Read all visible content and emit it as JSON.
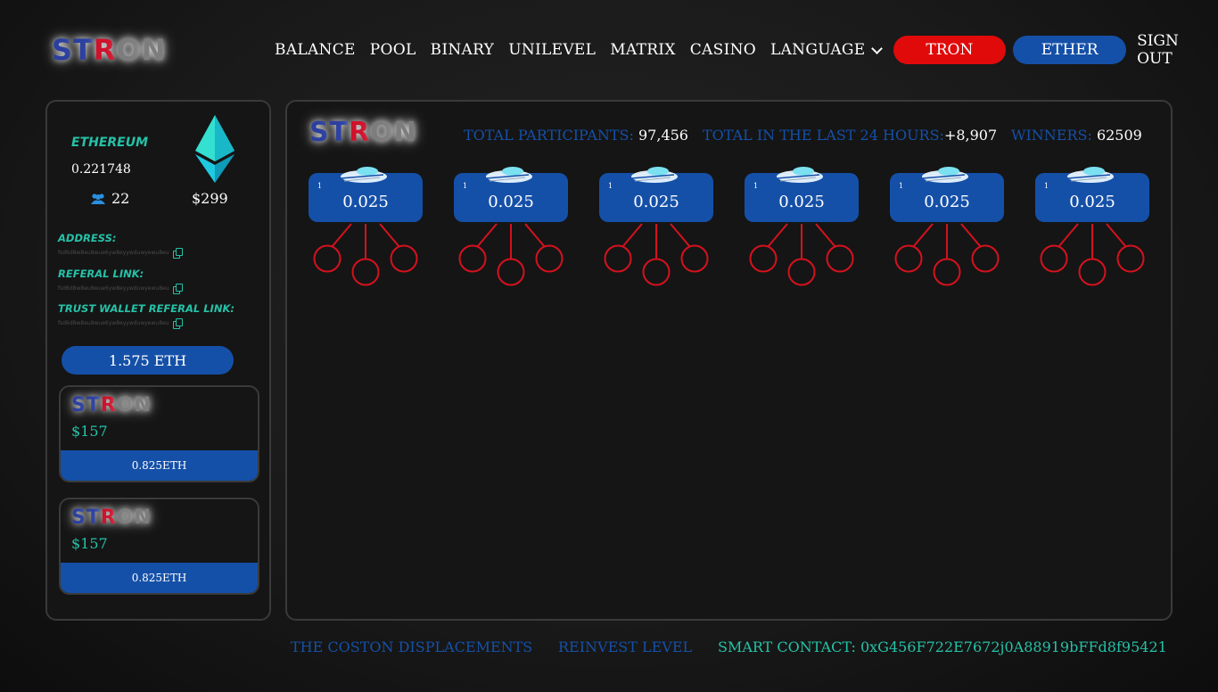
{
  "brand": {
    "letters": [
      "S",
      "T",
      "R",
      "O",
      "N"
    ]
  },
  "nav": {
    "items": [
      "BALANCE",
      "POOL",
      "BINARY",
      "UNILEVEL",
      "MATRIX",
      "CASINO"
    ],
    "language": "LANGUAGE",
    "tron": "TRON",
    "ether": "ETHER",
    "sign_out": "SIGN OUT"
  },
  "wallet": {
    "coin": "ETHEREUM",
    "amount": "0.221748",
    "users": "22",
    "usd": "$299",
    "address_label": "ADDRESS:",
    "address_value": "fsd6d8w8eu8wue6yw8eyywduwyewu8eu",
    "referral_label": "REFERAL LINK:",
    "referral_value": "fsd6d8w8eu8wue6yw8eyywduwyewu8eu",
    "trust_label": "TRUST WALLET REFERAL LINK:",
    "trust_value": "fsd6d8w8eu8wue6yw8eyywduwyewu8eu",
    "balance": "1.575 ETH"
  },
  "mini_cards": [
    {
      "usd": "$157",
      "eth": "0.825ETH"
    },
    {
      "usd": "$157",
      "eth": "0.825ETH"
    }
  ],
  "stats": {
    "participants_label": "TOTAL PARTICIPANTS:",
    "participants_value": "97,456",
    "last24_label": "TOTAL IN THE LAST 24 HOURS:",
    "last24_value": "+8,907",
    "winners_label": "WINNERS:",
    "winners_value": "62509"
  },
  "slots": [
    {
      "level": "1",
      "price": "0.025"
    },
    {
      "level": "1",
      "price": "0.025"
    },
    {
      "level": "1",
      "price": "0.025"
    },
    {
      "level": "1",
      "price": "0.025"
    },
    {
      "level": "1",
      "price": "0.025"
    },
    {
      "level": "1",
      "price": "0.025"
    }
  ],
  "footer": {
    "displacements": "THE COSTON DISPLACEMENTS",
    "reinvest": "REINVEST LEVEL",
    "contract": "SMART CONTACT: 0xG456F722E7672j0A88919bFFd8f95421"
  },
  "colors": {
    "blue": "#1550a8",
    "teal": "#25c2a8",
    "red": "#e00a0a",
    "tree_red": "#d4121e"
  },
  "icons": [
    "users-icon",
    "copy-icon",
    "ethereum-diamond-icon",
    "spaceship-icon",
    "chevron-down-icon"
  ]
}
